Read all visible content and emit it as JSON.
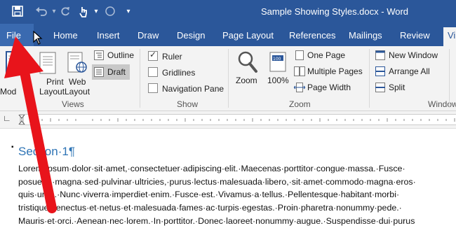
{
  "window": {
    "title": "Sample Showing Styles.docx - Word"
  },
  "qat": {
    "save_icon": "save-icon",
    "undo_icon": "undo-icon",
    "redo_icon": "redo-icon",
    "touch_icon": "touch-mode-icon",
    "circle_icon": "circle-icon",
    "customize_icon": "chevron-down-icon"
  },
  "tabs": [
    {
      "label": "File"
    },
    {
      "label": "Home"
    },
    {
      "label": "Insert"
    },
    {
      "label": "Draw"
    },
    {
      "label": "Design"
    },
    {
      "label": "Page Layout"
    },
    {
      "label": "References"
    },
    {
      "label": "Mailings"
    },
    {
      "label": "Review"
    },
    {
      "label": "Vi"
    }
  ],
  "ribbon": {
    "views": {
      "label": "Views",
      "read_mode": "Read Mode",
      "read_mode_short": "Mod",
      "print_layout_line1": "Print",
      "print_layout_line2": "Layout",
      "web_layout_line1": "Web",
      "web_layout_line2": "Layout",
      "outline": "Outline",
      "draft": "Draft"
    },
    "show": {
      "label": "Show",
      "ruler": "Ruler",
      "gridlines": "Gridlines",
      "navigation_pane": "Navigation Pane"
    },
    "zoom": {
      "label": "Zoom",
      "zoom": "Zoom",
      "percent": "100%",
      "one_page": "One Page",
      "multiple_pages": "Multiple Pages",
      "page_width": "Page Width"
    },
    "window": {
      "label": "Window",
      "new_window": "New Window",
      "arrange_all": "Arrange All",
      "split": "Split"
    }
  },
  "document": {
    "heading": "Section·1¶",
    "lines": [
      "Lorem·ipsum·dolor·sit·amet,·consectetuer·adipiscing·elit.·Maecenas·porttitor·congue·massa.·Fusce·",
      "posuere,·magna·sed·pulvinar·ultricies,·purus·lectus·malesuada·libero,·sit·amet·commodo·magna·eros·",
      "quis·urna.·Nunc·viverra·imperdiet·enim.·Fusce·est.·Vivamus·a·tellus.·Pellentesque·habitant·morbi·",
      "tristique·senectus·et·netus·et·malesuada·fames·ac·turpis·egestas.·Proin·pharetra·nonummy·pede.·",
      "Mauris·et·orci.·Aenean·nec·lorem.·In·porttitor.·Donec·laoreet·nonummy·augue.·Suspendisse·dui·purus"
    ]
  },
  "colors": {
    "accent": "#2b579a",
    "heading": "#2e74b5",
    "annotation_arrow": "#e8141b"
  }
}
